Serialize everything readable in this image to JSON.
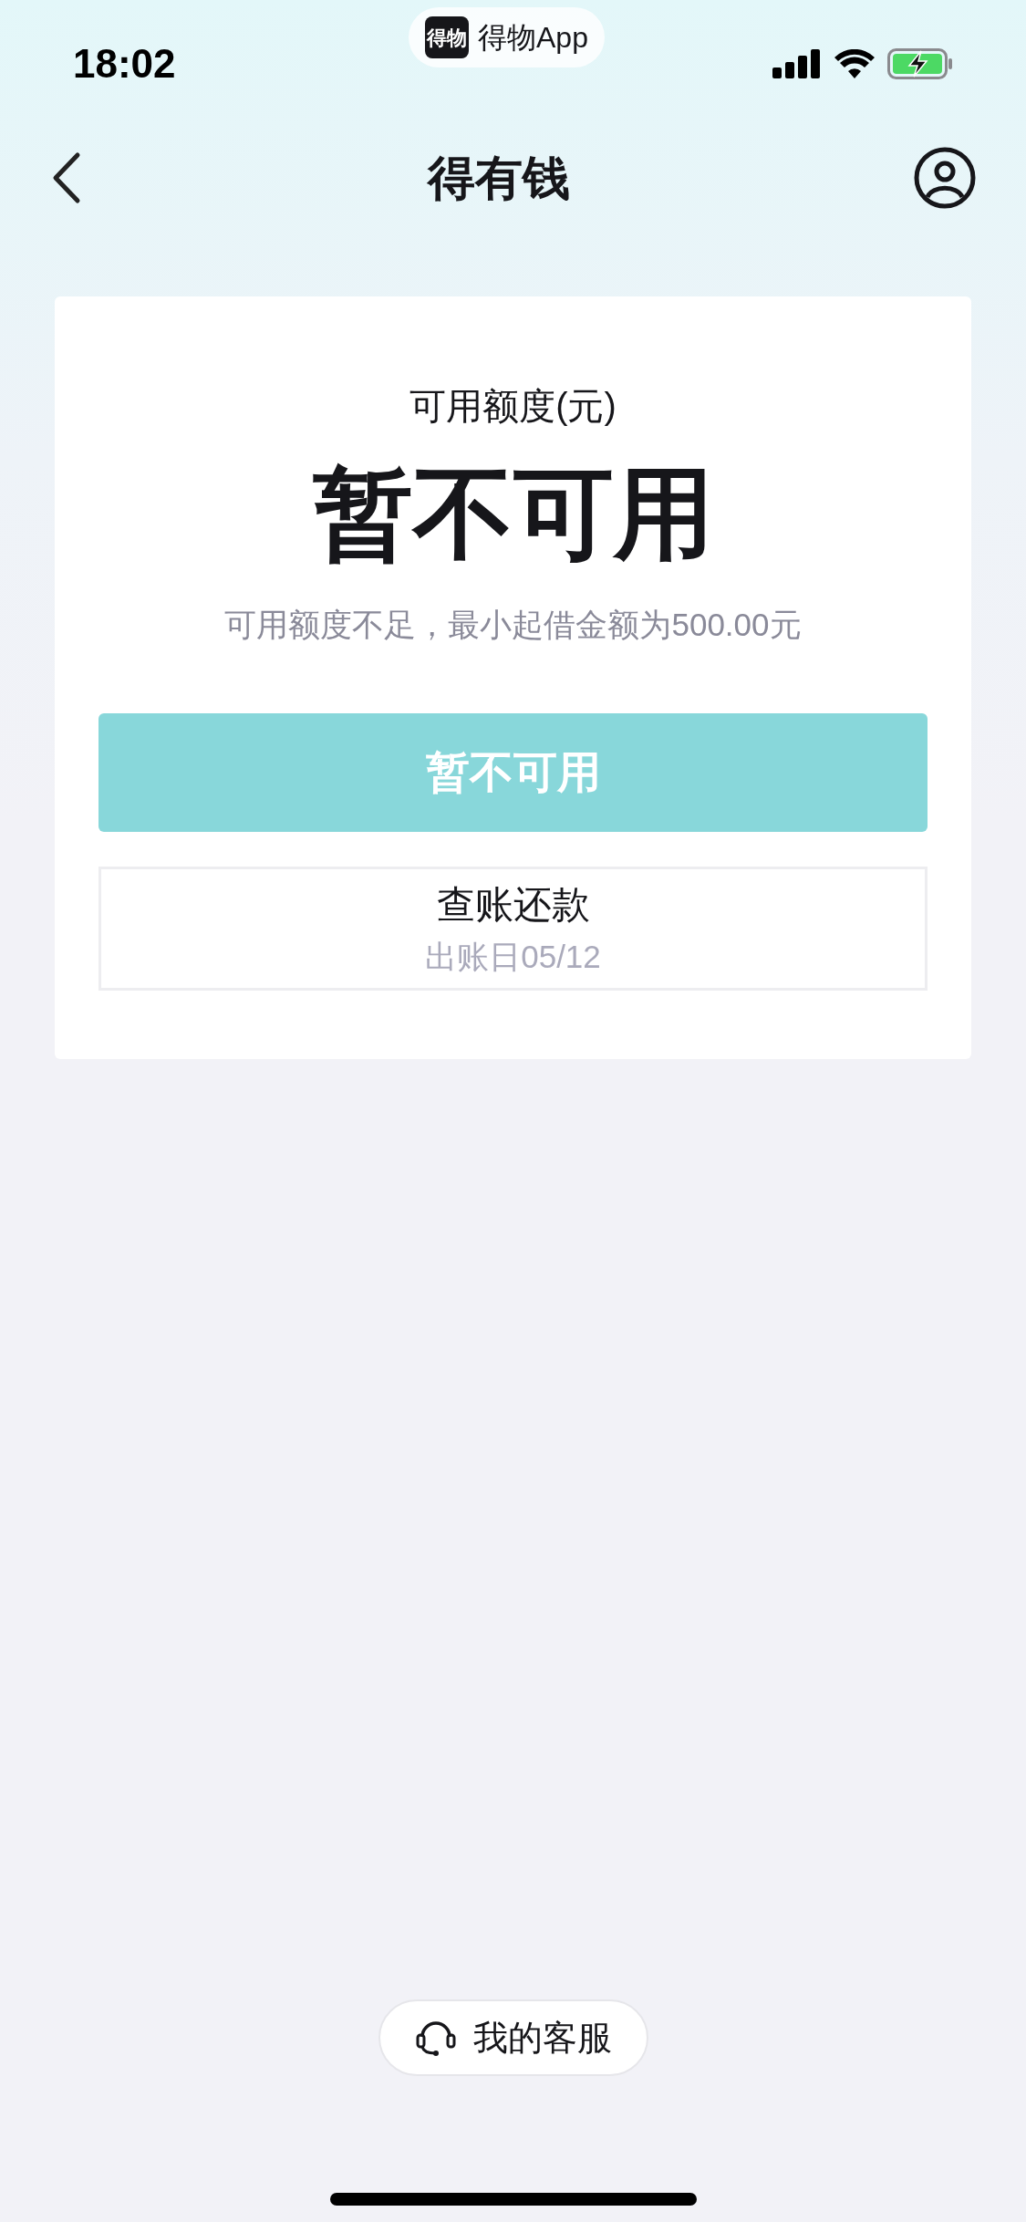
{
  "status_bar": {
    "time": "18:02",
    "app_pill": {
      "logo": "得物",
      "name": "得物App"
    }
  },
  "nav": {
    "title": "得有钱"
  },
  "card": {
    "label": "可用额度(元)",
    "amount": "暂不可用",
    "hint": "可用额度不足，最小起借金额为500.00元",
    "primary_button": {
      "label": "暂不可用",
      "disabled": true
    },
    "bill_button": {
      "label": "查账还款",
      "sub": "出账日05/12"
    }
  },
  "service_button": {
    "label": "我的客服"
  }
}
